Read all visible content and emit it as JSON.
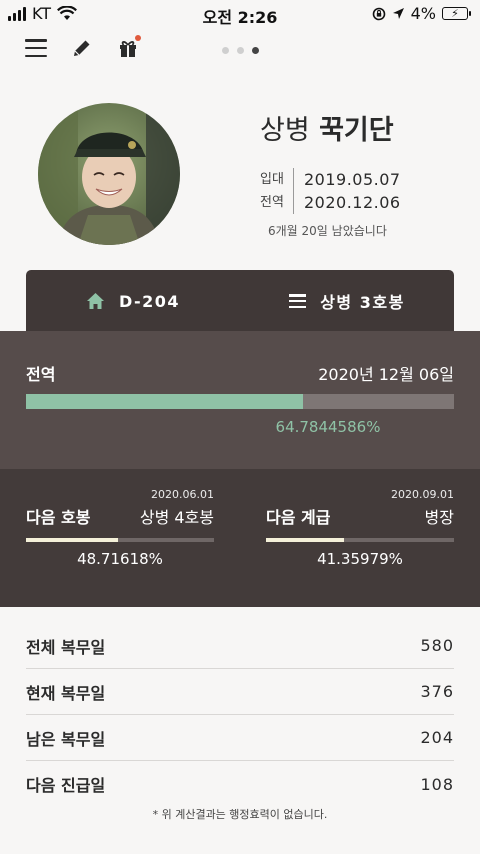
{
  "status_bar": {
    "carrier": "KT",
    "time": "오전 2:26",
    "battery_pct": "4%"
  },
  "toolbar": {
    "menu_icon": "hamburger-icon",
    "edit_icon": "pencil-icon",
    "gift_icon": "gift-icon",
    "pager_active_index": 2,
    "pager_count": 3
  },
  "profile": {
    "rank": "상병",
    "name": "꾹기단",
    "enlist_label": "입대",
    "enlist_date": "2019.05.07",
    "discharge_label": "전역",
    "discharge_date": "2020.12.06",
    "remaining": "6개월 20일 남았습니다"
  },
  "tabs": [
    {
      "label": "D-204",
      "icon": "home-icon"
    },
    {
      "label": "상병 3호봉",
      "icon": "list-icon"
    }
  ],
  "discharge_progress": {
    "title": "전역",
    "date": "2020년 12월 06일",
    "percent_text": "64.7844586%",
    "fraction": 0.647844586
  },
  "next_step": {
    "label": "다음 호봉",
    "date": "2020.06.01",
    "target": "상병 4호봉",
    "percent_text": "48.71618%",
    "fraction": 0.4871618
  },
  "next_rank": {
    "label": "다음 계급",
    "date": "2020.09.01",
    "target": "병장",
    "percent_text": "41.35979%",
    "fraction": 0.4135979
  },
  "stats": [
    {
      "label": "전체 복무일",
      "value": "580"
    },
    {
      "label": "현재 복무일",
      "value": "376"
    },
    {
      "label": "남은 복무일",
      "value": "204"
    },
    {
      "label": "다음 진급일",
      "value": "108"
    }
  ],
  "footnote": "* 위 계산결과는 행정효력이 없습니다.",
  "colors": {
    "accent_green": "#8fc2a6",
    "panel_dark": "#433b3a",
    "panel_mid": "#564c4b",
    "tab_bg": "#403837",
    "progress_cream": "#f5f1d9"
  }
}
